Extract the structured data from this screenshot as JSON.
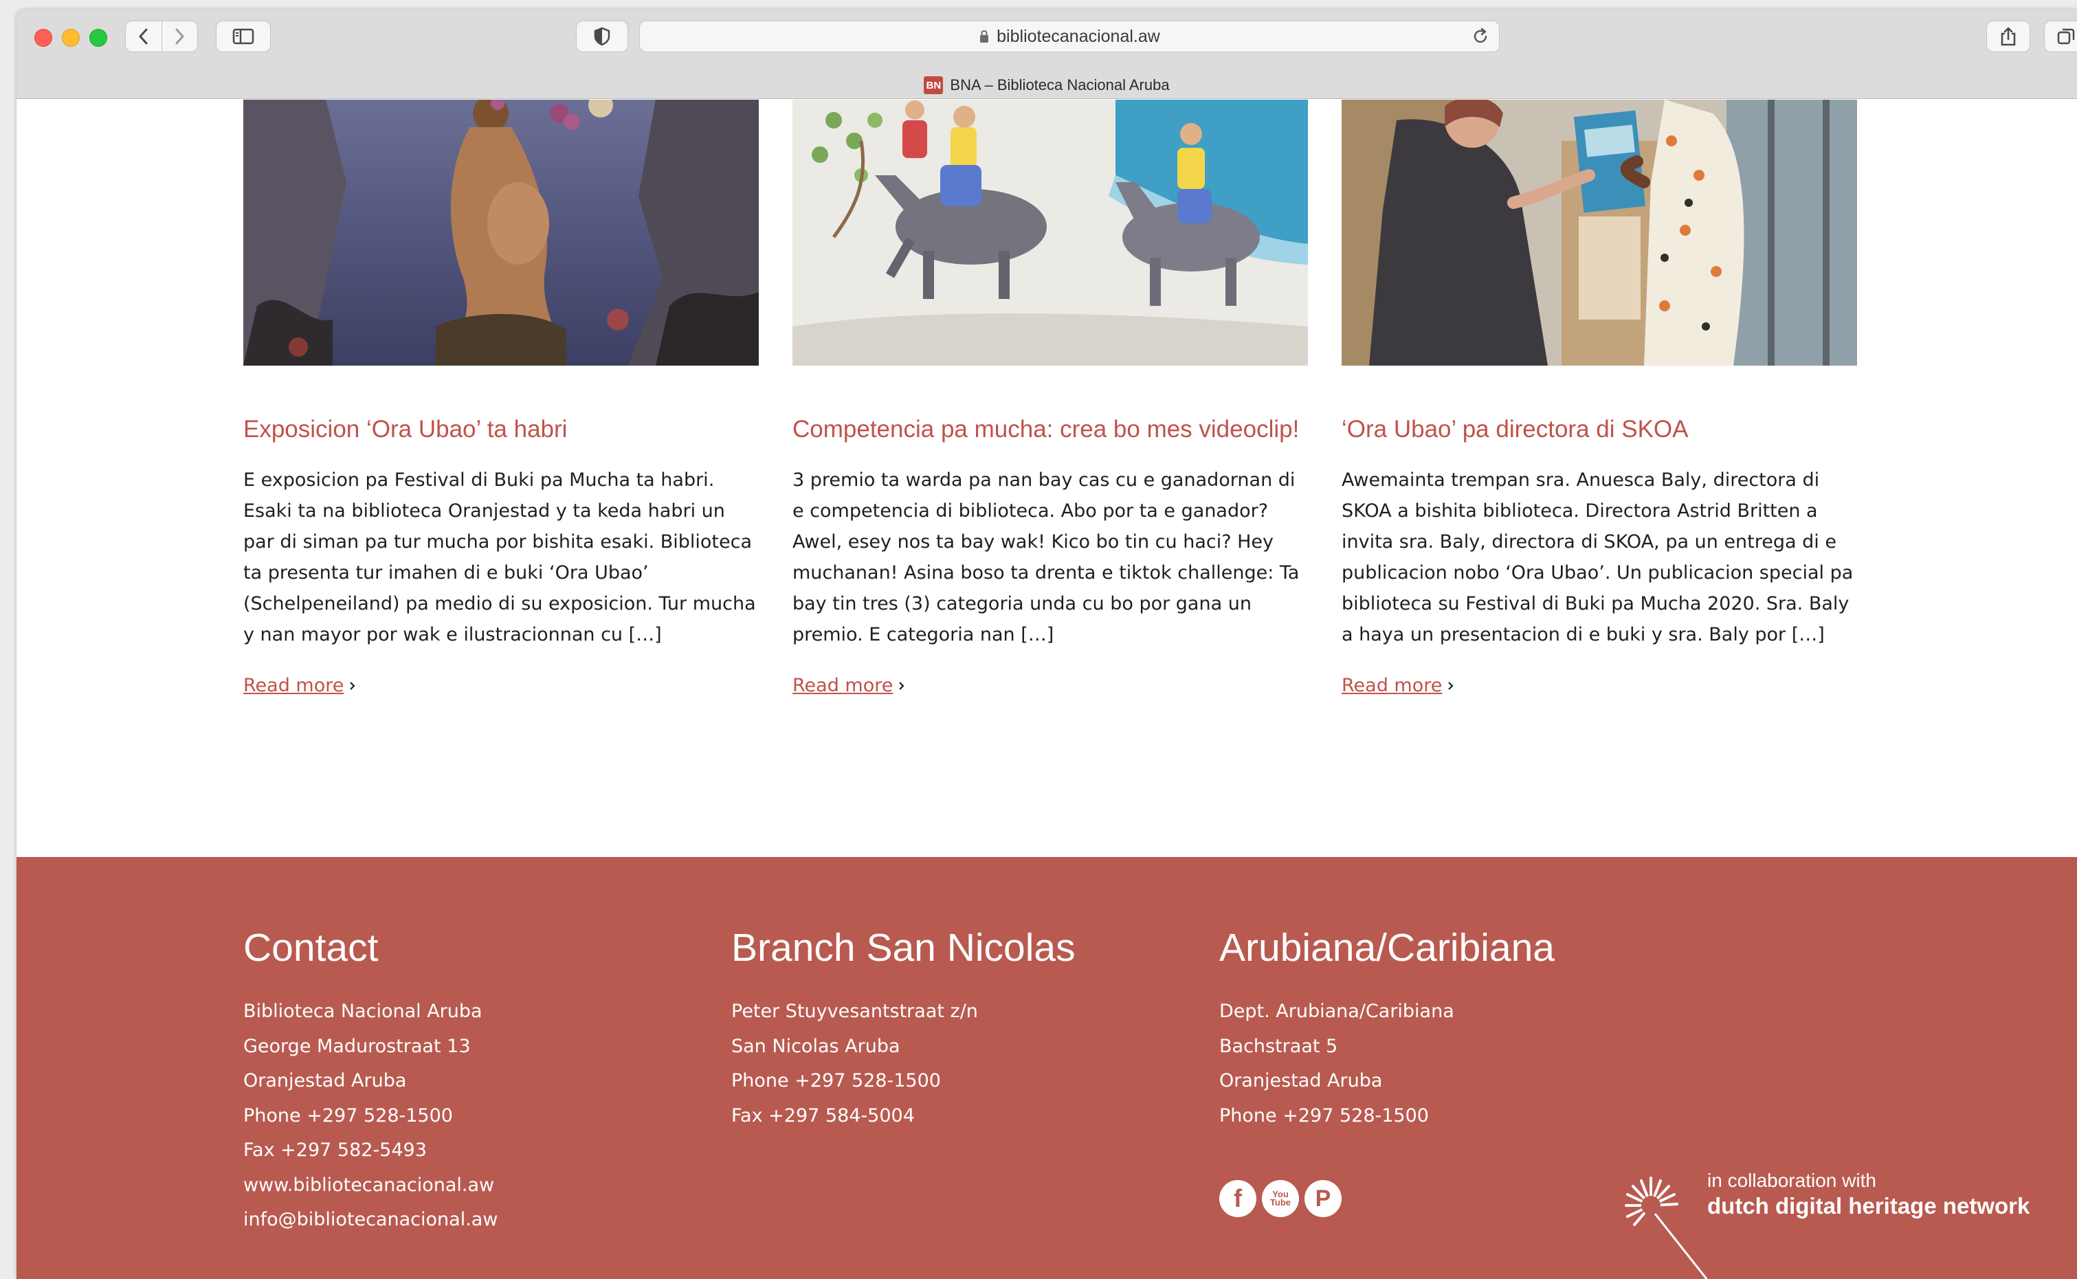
{
  "browser": {
    "url": "bibliotecanacional.aw",
    "tab_title": "BNA – Biblioteca Nacional Aruba",
    "favicon_text": "BN"
  },
  "articles": [
    {
      "title": "Exposicion ‘Ora Ubao’ ta habri",
      "excerpt": "E exposicion pa Festival di Buki pa Mucha ta habri. Esaki ta na biblioteca Oranjestad y ta keda habri un par di siman pa tur mucha por bishita esaki. Biblioteca ta presenta tur imahen di e buki ‘Ora Ubao’ (Schelpeneiland) pa medio di su exposicion. Tur mucha y nan mayor por wak e ilustracionnan cu […]",
      "read_more": "Read more"
    },
    {
      "title": "Competencia pa mucha: crea bo mes videoclip!",
      "excerpt": "3 premio ta warda pa nan bay cas cu e ganadornan di e competencia di biblioteca. Abo por ta e ganador? Awel, esey nos ta bay wak! Kico bo tin cu haci? Hey muchanan!  Asina boso ta drenta e tiktok challenge: Ta bay tin tres (3) categoria unda cu bo por gana un premio. E categoria nan […]",
      "read_more": "Read more"
    },
    {
      "title": "‘Ora Ubao’ pa directora di SKOA",
      "excerpt": "Awemainta trempan sra. Anuesca Baly, directora di SKOA a bishita biblioteca. Directora Astrid Britten a invita sra. Baly, directora di SKOA, pa un entrega di e publicacion nobo ‘Ora Ubao’. Un publicacion special pa biblioteca su Festival di Buki pa Mucha 2020. Sra. Baly a haya un presentacion di e buki y sra. Baly por […]",
      "read_more": "Read more"
    }
  ],
  "footer": {
    "contact": {
      "heading": "Contact",
      "lines": [
        "Biblioteca Nacional Aruba",
        "George Madurostraat 13",
        "Oranjestad Aruba",
        "Phone +297 528-1500",
        "Fax +297 582-5493",
        "www.bibliotecanacional.aw",
        "info@bibliotecanacional.aw"
      ]
    },
    "branch": {
      "heading": "Branch San Nicolas",
      "lines": [
        "Peter Stuyvesantstraat z/n",
        "San Nicolas Aruba",
        "Phone +297 528-1500",
        "Fax +297 584-5004"
      ]
    },
    "arubiana": {
      "heading": "Arubiana/Caribiana",
      "lines": [
        "Dept. Arubiana/Caribiana",
        "Bachstraat 5",
        "Oranjestad Aruba",
        "Phone +297 528-1500"
      ]
    },
    "socials": {
      "facebook": "f",
      "youtube_top": "You",
      "youtube_bottom": "Tube",
      "pinterest": "P"
    },
    "collab": {
      "small": "in collaboration with",
      "big": "dutch digital heritage network"
    }
  },
  "colors": {
    "accent": "#c0524a",
    "footer_bg": "#b85a50"
  }
}
